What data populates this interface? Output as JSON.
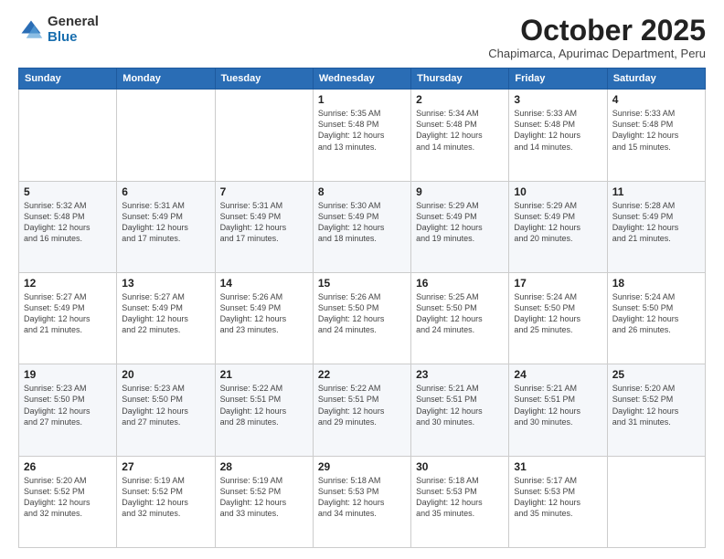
{
  "logo": {
    "general": "General",
    "blue": "Blue"
  },
  "header": {
    "month": "October 2025",
    "location": "Chapimarca, Apurimac Department, Peru"
  },
  "weekdays": [
    "Sunday",
    "Monday",
    "Tuesday",
    "Wednesday",
    "Thursday",
    "Friday",
    "Saturday"
  ],
  "weeks": [
    [
      {
        "day": "",
        "info": ""
      },
      {
        "day": "",
        "info": ""
      },
      {
        "day": "",
        "info": ""
      },
      {
        "day": "1",
        "info": "Sunrise: 5:35 AM\nSunset: 5:48 PM\nDaylight: 12 hours\nand 13 minutes."
      },
      {
        "day": "2",
        "info": "Sunrise: 5:34 AM\nSunset: 5:48 PM\nDaylight: 12 hours\nand 14 minutes."
      },
      {
        "day": "3",
        "info": "Sunrise: 5:33 AM\nSunset: 5:48 PM\nDaylight: 12 hours\nand 14 minutes."
      },
      {
        "day": "4",
        "info": "Sunrise: 5:33 AM\nSunset: 5:48 PM\nDaylight: 12 hours\nand 15 minutes."
      }
    ],
    [
      {
        "day": "5",
        "info": "Sunrise: 5:32 AM\nSunset: 5:48 PM\nDaylight: 12 hours\nand 16 minutes."
      },
      {
        "day": "6",
        "info": "Sunrise: 5:31 AM\nSunset: 5:49 PM\nDaylight: 12 hours\nand 17 minutes."
      },
      {
        "day": "7",
        "info": "Sunrise: 5:31 AM\nSunset: 5:49 PM\nDaylight: 12 hours\nand 17 minutes."
      },
      {
        "day": "8",
        "info": "Sunrise: 5:30 AM\nSunset: 5:49 PM\nDaylight: 12 hours\nand 18 minutes."
      },
      {
        "day": "9",
        "info": "Sunrise: 5:29 AM\nSunset: 5:49 PM\nDaylight: 12 hours\nand 19 minutes."
      },
      {
        "day": "10",
        "info": "Sunrise: 5:29 AM\nSunset: 5:49 PM\nDaylight: 12 hours\nand 20 minutes."
      },
      {
        "day": "11",
        "info": "Sunrise: 5:28 AM\nSunset: 5:49 PM\nDaylight: 12 hours\nand 21 minutes."
      }
    ],
    [
      {
        "day": "12",
        "info": "Sunrise: 5:27 AM\nSunset: 5:49 PM\nDaylight: 12 hours\nand 21 minutes."
      },
      {
        "day": "13",
        "info": "Sunrise: 5:27 AM\nSunset: 5:49 PM\nDaylight: 12 hours\nand 22 minutes."
      },
      {
        "day": "14",
        "info": "Sunrise: 5:26 AM\nSunset: 5:49 PM\nDaylight: 12 hours\nand 23 minutes."
      },
      {
        "day": "15",
        "info": "Sunrise: 5:26 AM\nSunset: 5:50 PM\nDaylight: 12 hours\nand 24 minutes."
      },
      {
        "day": "16",
        "info": "Sunrise: 5:25 AM\nSunset: 5:50 PM\nDaylight: 12 hours\nand 24 minutes."
      },
      {
        "day": "17",
        "info": "Sunrise: 5:24 AM\nSunset: 5:50 PM\nDaylight: 12 hours\nand 25 minutes."
      },
      {
        "day": "18",
        "info": "Sunrise: 5:24 AM\nSunset: 5:50 PM\nDaylight: 12 hours\nand 26 minutes."
      }
    ],
    [
      {
        "day": "19",
        "info": "Sunrise: 5:23 AM\nSunset: 5:50 PM\nDaylight: 12 hours\nand 27 minutes."
      },
      {
        "day": "20",
        "info": "Sunrise: 5:23 AM\nSunset: 5:50 PM\nDaylight: 12 hours\nand 27 minutes."
      },
      {
        "day": "21",
        "info": "Sunrise: 5:22 AM\nSunset: 5:51 PM\nDaylight: 12 hours\nand 28 minutes."
      },
      {
        "day": "22",
        "info": "Sunrise: 5:22 AM\nSunset: 5:51 PM\nDaylight: 12 hours\nand 29 minutes."
      },
      {
        "day": "23",
        "info": "Sunrise: 5:21 AM\nSunset: 5:51 PM\nDaylight: 12 hours\nand 30 minutes."
      },
      {
        "day": "24",
        "info": "Sunrise: 5:21 AM\nSunset: 5:51 PM\nDaylight: 12 hours\nand 30 minutes."
      },
      {
        "day": "25",
        "info": "Sunrise: 5:20 AM\nSunset: 5:52 PM\nDaylight: 12 hours\nand 31 minutes."
      }
    ],
    [
      {
        "day": "26",
        "info": "Sunrise: 5:20 AM\nSunset: 5:52 PM\nDaylight: 12 hours\nand 32 minutes."
      },
      {
        "day": "27",
        "info": "Sunrise: 5:19 AM\nSunset: 5:52 PM\nDaylight: 12 hours\nand 32 minutes."
      },
      {
        "day": "28",
        "info": "Sunrise: 5:19 AM\nSunset: 5:52 PM\nDaylight: 12 hours\nand 33 minutes."
      },
      {
        "day": "29",
        "info": "Sunrise: 5:18 AM\nSunset: 5:53 PM\nDaylight: 12 hours\nand 34 minutes."
      },
      {
        "day": "30",
        "info": "Sunrise: 5:18 AM\nSunset: 5:53 PM\nDaylight: 12 hours\nand 35 minutes."
      },
      {
        "day": "31",
        "info": "Sunrise: 5:17 AM\nSunset: 5:53 PM\nDaylight: 12 hours\nand 35 minutes."
      },
      {
        "day": "",
        "info": ""
      }
    ]
  ]
}
